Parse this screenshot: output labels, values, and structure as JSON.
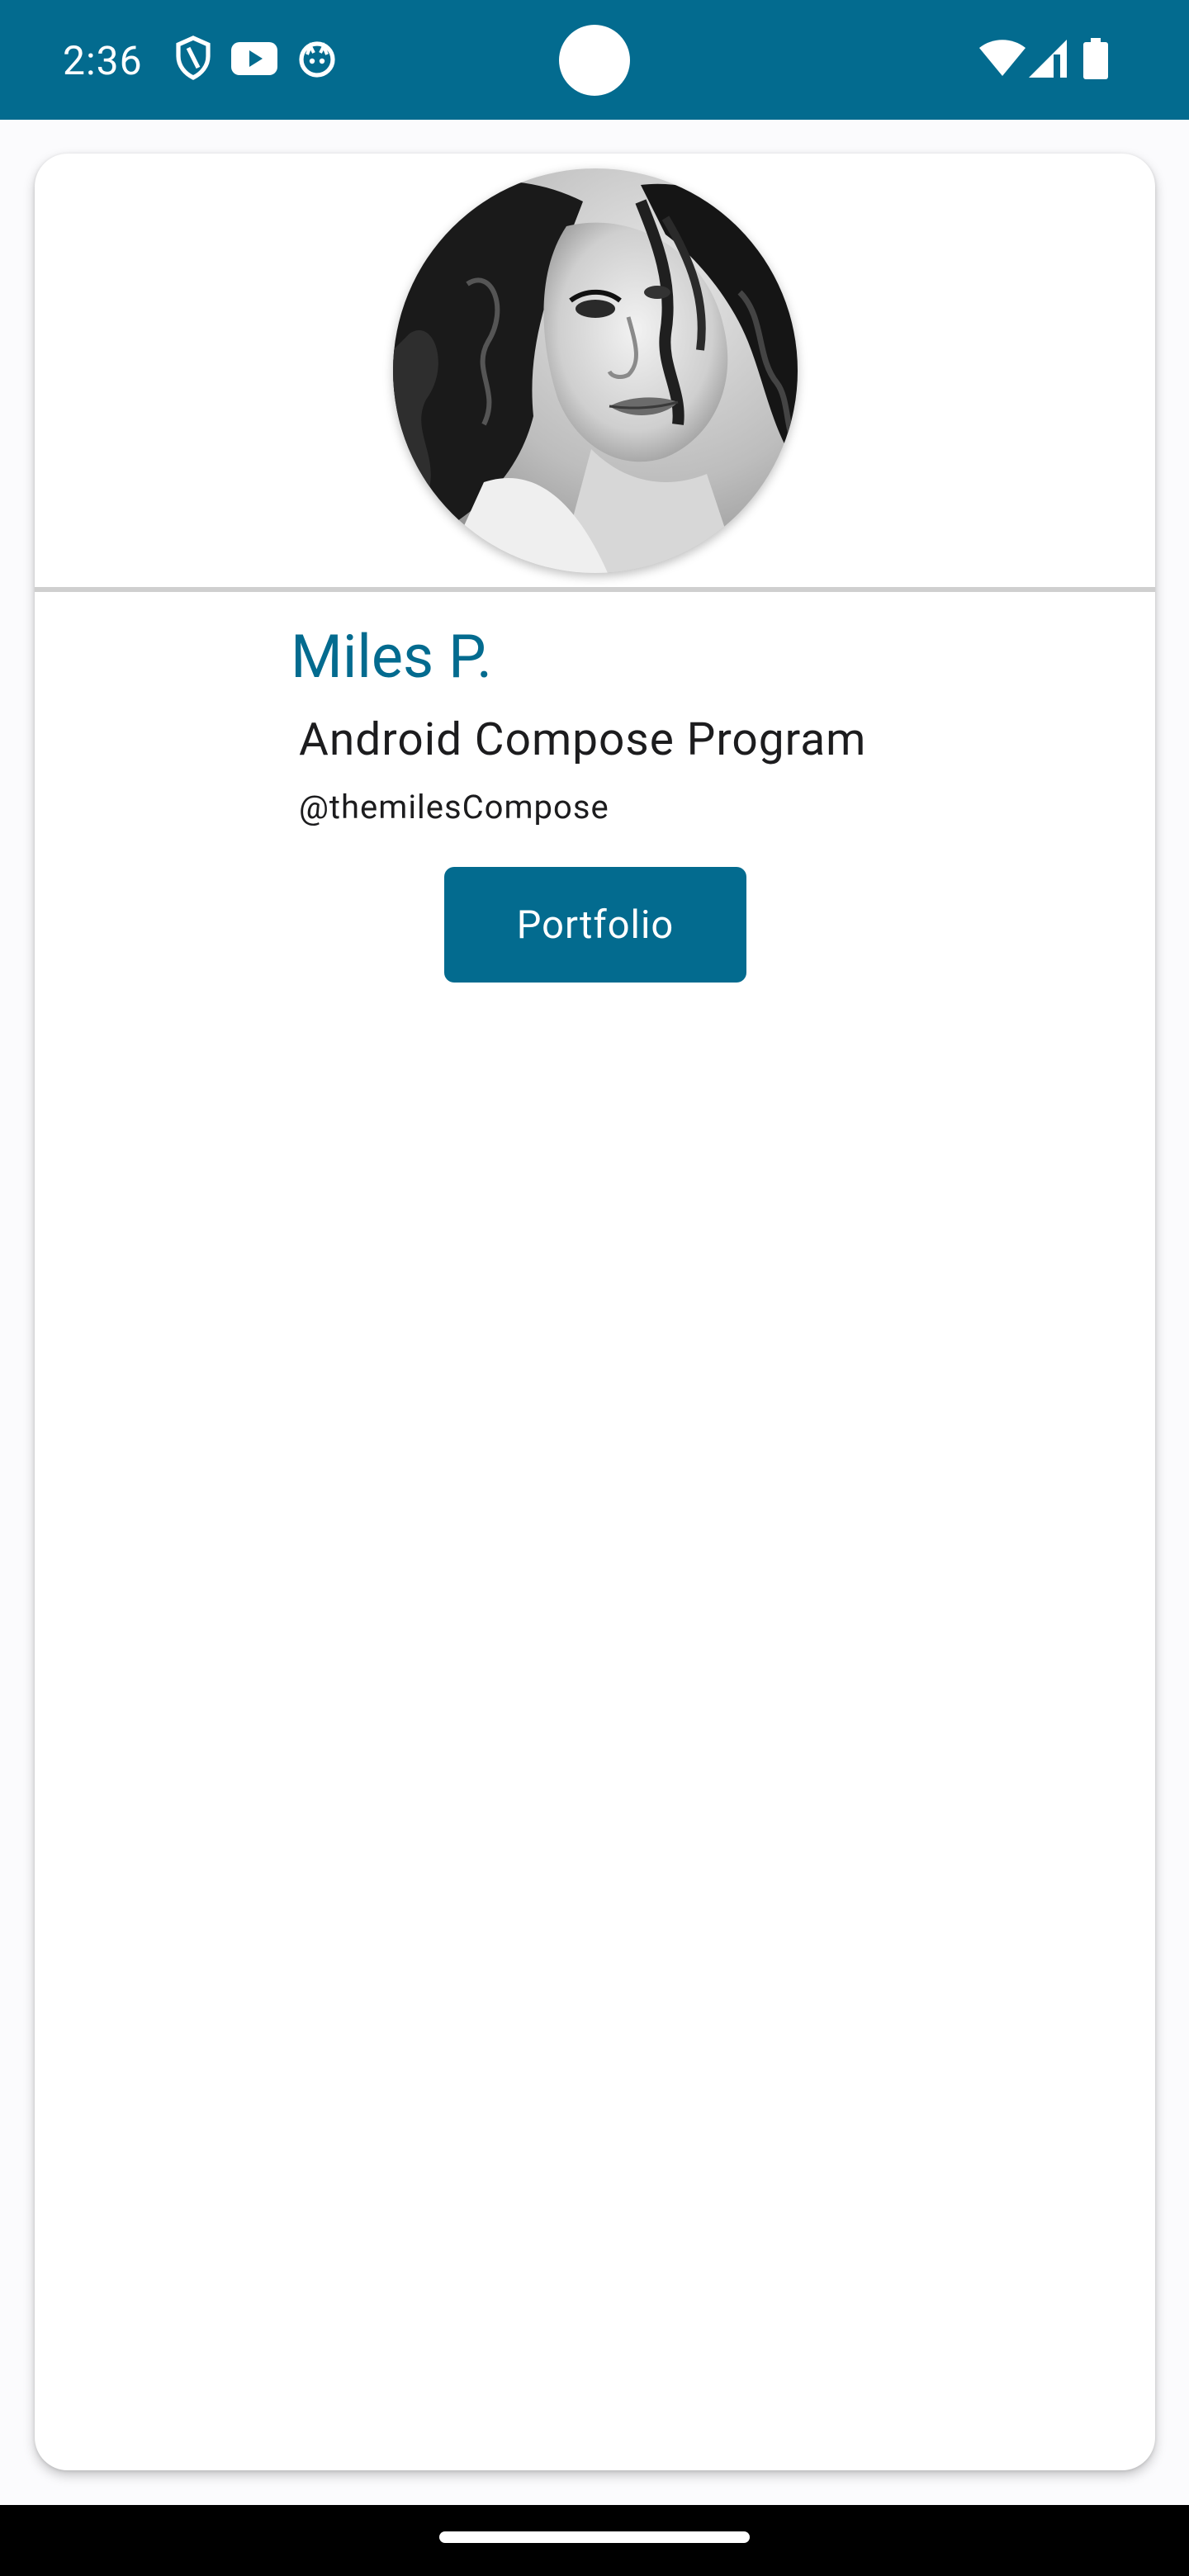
{
  "status_bar": {
    "time": "2:36",
    "left_icons": [
      "shield-icon",
      "youtube-icon",
      "app-notification-icon"
    ],
    "right_icons": [
      "wifi-icon",
      "cell-signal-icon",
      "battery-icon"
    ],
    "background_color": "#036b8f"
  },
  "profile": {
    "avatar_alt": "Profile photo",
    "name": "Miles P.",
    "subtitle": "Android Compose Program",
    "handle": "@themilesCompose",
    "portfolio_label": "Portfolio",
    "accent_color": "#036b8f"
  }
}
